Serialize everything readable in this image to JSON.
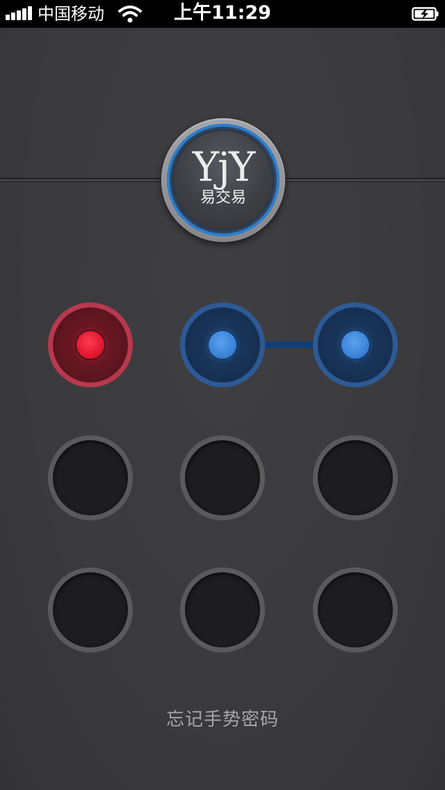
{
  "status_bar": {
    "carrier": "中国移动",
    "time": "上午11:29",
    "signal_icon": "signal-bars-icon",
    "wifi_icon": "wifi-icon",
    "battery_icon": "battery-charging-icon"
  },
  "logo": {
    "mark": "YjY",
    "name": "易交易"
  },
  "gesture_grid": {
    "nodes": [
      {
        "state": "error"
      },
      {
        "state": "selected"
      },
      {
        "state": "selected"
      },
      {
        "state": "idle"
      },
      {
        "state": "idle"
      },
      {
        "state": "idle"
      },
      {
        "state": "idle"
      },
      {
        "state": "idle"
      },
      {
        "state": "idle"
      }
    ]
  },
  "forgot_link": "忘记手势密码",
  "colors": {
    "background": "#3b3b3e",
    "selected_accent": "#3b84d8",
    "error_accent": "#e01830",
    "idle_ring": "#5a5a5d"
  }
}
